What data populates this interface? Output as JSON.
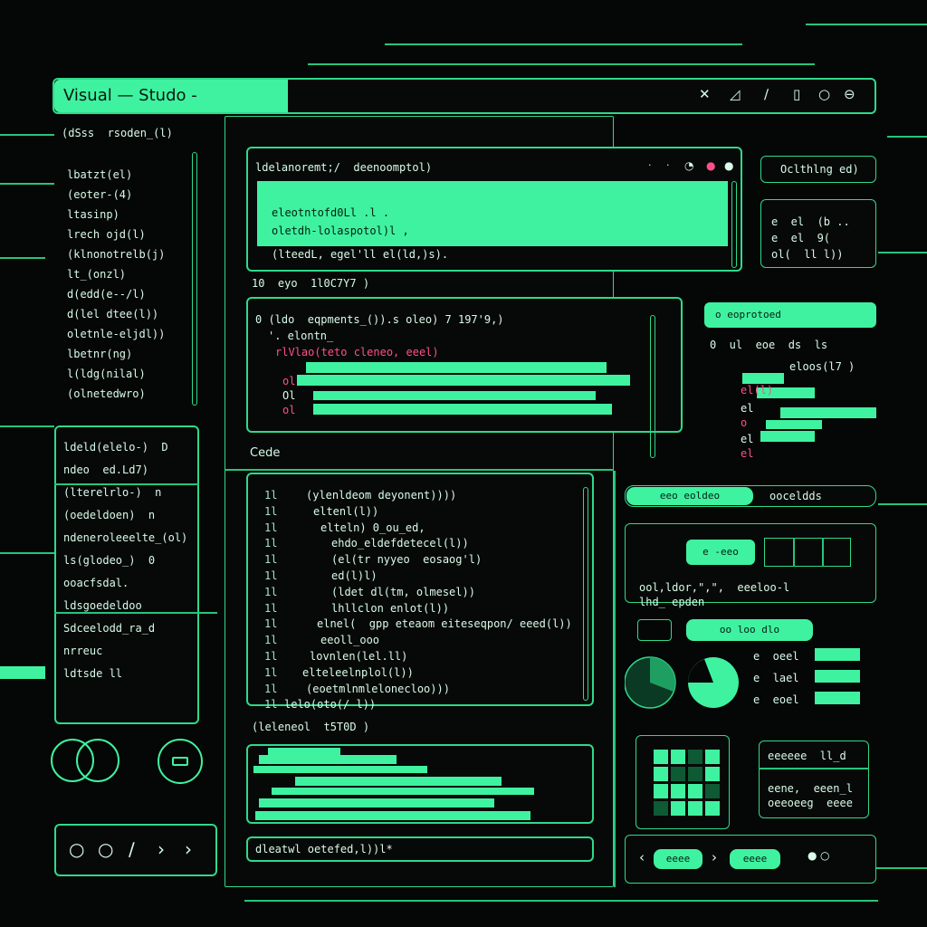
{
  "window": {
    "title": "Visual — Studo -",
    "controls": [
      "close-icon",
      "signal-icon",
      "slash-icon",
      "pause-icon",
      "circle-icon",
      "minimize-icon"
    ]
  },
  "explorer": {
    "header": "(dSss  rsoden_(l)",
    "items": [
      "lbatzt(el)",
      "(eoter-(4)",
      "ltasinp)",
      "lrech ojd(l)",
      "(klnonotrelb(j)",
      "lt_(onzl)",
      "d(edd(e--/l)",
      "d(lel dtee(l))",
      "oletnle-eljdl))",
      "lbetnr(ng)",
      "l(ldg(nilal)",
      "(olnetedwro)"
    ]
  },
  "outline": {
    "items": [
      "ldeld(elelo-)  D",
      "ndeo  ed.Ld7)",
      "(lterelrlo-)  n",
      "(oedeldoen)  n",
      "ndeneroleeelte_(ol)",
      "ls(glodeo_)  0",
      "ooacfsdal.",
      "ldsgoedeldoo",
      "Sdceelodd_ra_d",
      "nrreuc",
      "ldtsde ll"
    ]
  },
  "bottom_left_toolbar": [
    "circle-icon",
    "circle-icon",
    "slash-icon",
    "chevron-right-icon",
    "chevron-right-icon"
  ],
  "editor_top": {
    "tab": "ldelanoremt;/  deenoomptol)",
    "lines": [
      "eleotntofd0Ll .l .",
      "oletdh-lolaspotol)l ,",
      "(lteedL, egel'll el(ld,)s)."
    ],
    "status": "10  eyo  1l0C7Y7 )"
  },
  "editor_mid": {
    "header": "0 (ldo  eqpments_()).s oleo) 7 197'9,)",
    "lines": [
      "'. elontn_",
      "rlVlao(teto cleneo, eeel)",
      "ol",
      "Ol",
      "ol"
    ]
  },
  "code_panel": {
    "label": "Cede",
    "lines": [
      "(ylenldeom deyonent))))",
      "eltenl(l))",
      "elteln) 0_ou_ed,",
      "ehdo_eldefdetecel(l))",
      "(el(tr nyyeo  eosaog'l)",
      "ed(l)l)",
      "(ldet dl(tm, olmesel))",
      "lhllclon enlot(l))",
      "elnel(  gpp eteaom eiteseqpon/ eeed(l))",
      "eeoll_ooo",
      "lovnlen(lel.ll)",
      "elteleelnplol(l))",
      "(eoetmlnmlelonecloo)))",
      "lelo(oto(/ l))"
    ],
    "line_number": "1l",
    "footer": "(leleneol  t5T0D )"
  },
  "output_panel": {
    "input": "dleatwl oetefed,l))l*"
  },
  "right_top": {
    "title": "Oclthlng ed)",
    "lines": [
      "e  el  (b ..",
      "e  el  9(",
      "ol(  ll l))"
    ]
  },
  "right_bar1": {
    "label": "o  eoprotoed"
  },
  "right_list": {
    "header": "0  ul  eoe  ds  ls",
    "items": [
      "el(l)",
      "el",
      "o",
      "el",
      "el"
    ],
    "side": "eloos(l7 )"
  },
  "right_bar2": {
    "tab1": "eeo  eoldeo",
    "tab2": "ooceldds"
  },
  "right_widget": {
    "button": "e  -eeo",
    "text1": "ool,ldor,\",\",  eeeloo-l",
    "text2": "lhd_ epden",
    "pill": "oo loo  dlo",
    "legend": [
      "e  oeel",
      "e  lael",
      "e  eoel"
    ]
  },
  "right_bottom_box": {
    "title": "eeeeee  ll_d",
    "lines": [
      "eene,  eeen_l",
      "oeeoeeg  eeee"
    ]
  },
  "bottom_right_bar": {
    "pill1": "eeee",
    "pill2": "eeee"
  },
  "colors": {
    "accent": "#3ff2a0",
    "border": "#2fd98b",
    "highlight": "#ff4f8a",
    "background": "#050606"
  }
}
